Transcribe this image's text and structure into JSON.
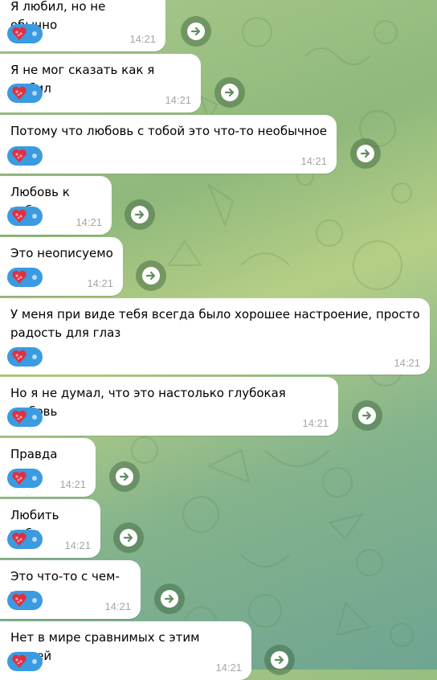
{
  "reaction": {
    "emoji": "heart-roses-icon",
    "color": "#3b9be0"
  },
  "messages": [
    {
      "text": "Я любил, но не обычно",
      "time": "14:21"
    },
    {
      "text": "Я не мог сказать как я любил",
      "time": "14:21"
    },
    {
      "text": "Потому что любовь с тобой это что-то необычное",
      "time": "14:21"
    },
    {
      "text": "Любовь к тебе",
      "time": "14:21"
    },
    {
      "text": "Это неописуемо",
      "time": "14:21"
    },
    {
      "text": "У меня при виде тебя всегда было хорошее настроение, просто радость для глаз",
      "time": "14:21"
    },
    {
      "text": "Но я не думал, что это настолько глубокая любовь",
      "time": "14:21"
    },
    {
      "text": "Правда",
      "time": "14:21"
    },
    {
      "text": "Любить тебя",
      "time": "14:21"
    },
    {
      "text": "Это что-то с чем-то",
      "time": "14:21"
    },
    {
      "text": "Нет в мире сравнимых с этим вещей",
      "time": "14:21"
    }
  ]
}
